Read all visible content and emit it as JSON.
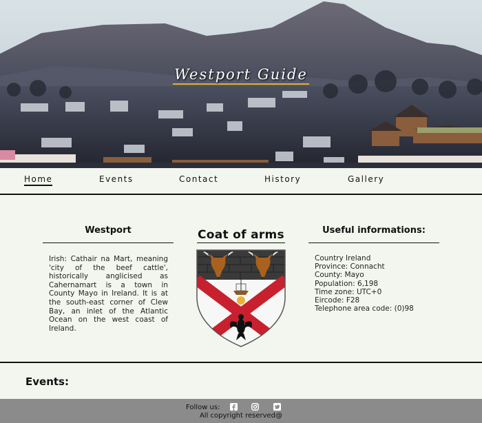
{
  "site": {
    "title": "Westport Guide"
  },
  "nav": {
    "items": [
      {
        "label": "Home",
        "active": true
      },
      {
        "label": "Events",
        "active": false
      },
      {
        "label": "Contact",
        "active": false
      },
      {
        "label": "History",
        "active": false
      },
      {
        "label": "Gallery",
        "active": false
      }
    ]
  },
  "about": {
    "title": "Westport",
    "text": "Irish: Cathair na Mart, meaning 'city of the beef cattle', historically anglicised as Cahernamart is a town in County Mayo in Ireland. It is at the south-east corner of Clew Bay, an inlet of the Atlantic Ocean on the west coast of Ireland."
  },
  "coat": {
    "title": "Coat of arms",
    "icon": "coat-of-arms-icon"
  },
  "info": {
    "title": "Useful informations:",
    "lines": [
      "Country Ireland",
      "Province: Connacht",
      "County: Mayo",
      "Population: 6,198",
      "Time zone: UTC+0",
      "Eircode: F28",
      "Telephone area code: (0)98"
    ]
  },
  "events": {
    "title": "Events:"
  },
  "footer": {
    "follow_label": "Follow us:",
    "social": [
      "facebook-icon",
      "instagram-icon",
      "twitter-icon"
    ],
    "copyright": "All copyright reserved@"
  },
  "colors": {
    "page_bg": "#f3f6ee",
    "footer_bg": "#8b8b8b",
    "title_underline": "#e0b133",
    "coat_red": "#c8202f",
    "coat_band": "#3a3a3a"
  }
}
